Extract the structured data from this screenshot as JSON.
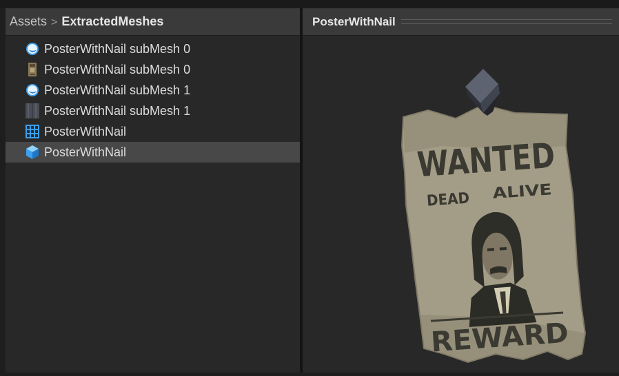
{
  "project": {
    "breadcrumb": {
      "root": "Assets",
      "separator": ">",
      "current": "ExtractedMeshes"
    },
    "items": [
      {
        "label": "PosterWithNail subMesh 0",
        "icon": "material-sphere-icon"
      },
      {
        "label": "PosterWithNail subMesh 0",
        "icon": "texture-thumbnail-icon"
      },
      {
        "label": "PosterWithNail subMesh 1",
        "icon": "material-sphere-icon"
      },
      {
        "label": "PosterWithNail subMesh 1",
        "icon": "texture-thumbnail-icon"
      },
      {
        "label": "PosterWithNail",
        "icon": "mesh-grid-icon"
      },
      {
        "label": "PosterWithNail",
        "icon": "prefab-cube-icon",
        "selected": true
      }
    ]
  },
  "preview": {
    "title": "PosterWithNail",
    "poster": {
      "line1": "WANTED",
      "line2": "DEAD",
      "line3": "ALIVE",
      "line4": "REWARD"
    }
  },
  "colors": {
    "panel": "#282828",
    "header": "#3a3a3a",
    "selection": "#484848",
    "accent_blue": "#3aa0f0",
    "poster_paper": "#a39c86",
    "poster_ink": "#3a3a32"
  }
}
